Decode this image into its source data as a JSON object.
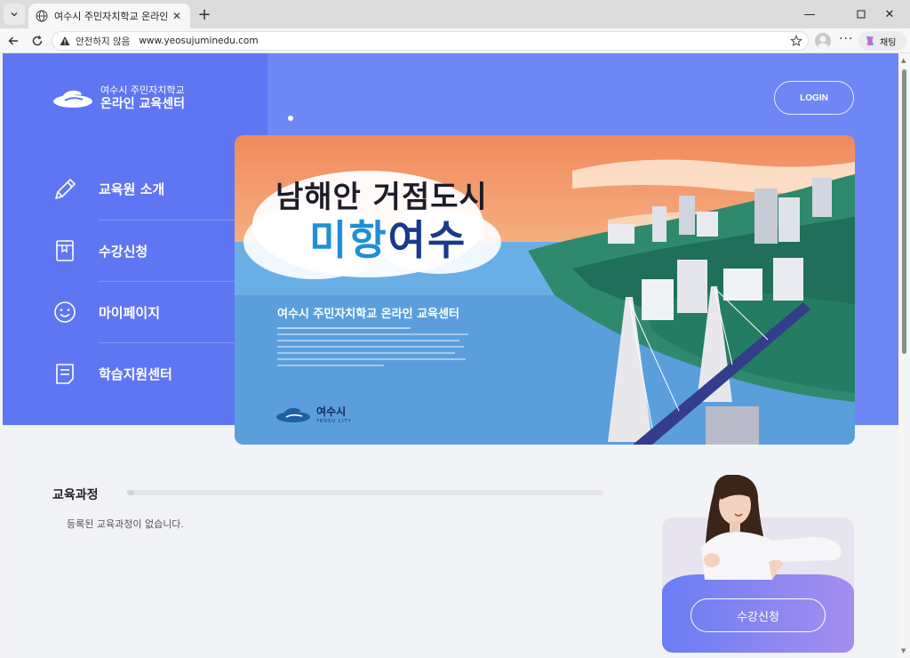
{
  "browser": {
    "tab_title": "여수시 주민자치학교 온라인 교육",
    "insecure_label": "안전하지 않음",
    "url": "www.yeosujuminedu.com",
    "copilot_label": "채팅"
  },
  "site": {
    "logo_line1": "여수시 주민자치학교",
    "logo_line2": "온라인 교육센터",
    "login_label": "LOGIN",
    "menu": [
      {
        "label": "교육원 소개",
        "icon": "pencil-icon"
      },
      {
        "label": "수강신청",
        "icon": "book-icon"
      },
      {
        "label": "마이페이지",
        "icon": "smiley-icon"
      },
      {
        "label": "학습지원센터",
        "icon": "document-icon"
      }
    ]
  },
  "banner": {
    "heading_line1": "남해안 거점도시",
    "heading_line2a": "미항",
    "heading_line2b": "여수",
    "subtitle": "여수시 주민자치학교 온라인 교육센터",
    "city_name": "여수시",
    "city_name_en": "YEOSU CITY"
  },
  "courses": {
    "title": "교육과정",
    "empty_message": "등록된 교육과정이 없습니다."
  },
  "promo": {
    "button_label": "수강신청"
  },
  "colors": {
    "hero": "#6f86f6",
    "sidebar": "#5f76f2",
    "page_bg": "#f2f3f6"
  }
}
